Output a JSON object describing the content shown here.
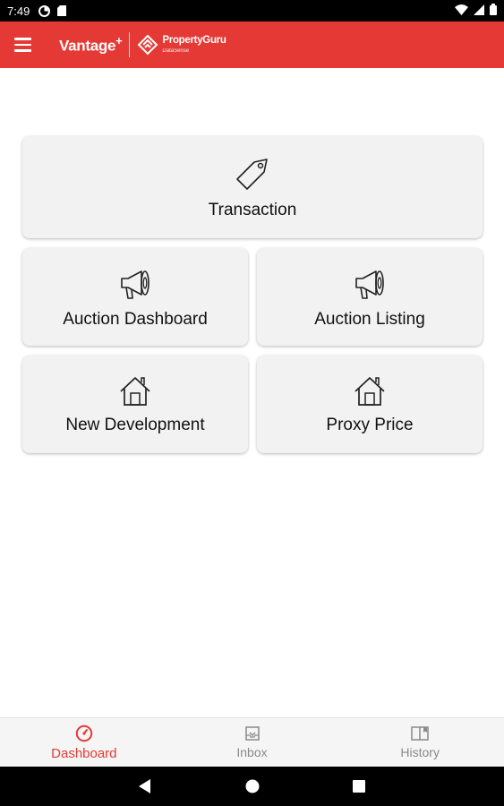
{
  "status_bar": {
    "time": "7:49",
    "icons": [
      "data-saver-icon",
      "sd-card-icon",
      "wifi-icon",
      "signal-icon",
      "battery-icon"
    ]
  },
  "app_bar": {
    "brand_main": "Vantage",
    "brand_plus": "+",
    "brand_partner": "PropertyGuru",
    "brand_partner_sub": "DataSense",
    "color": "#e53935"
  },
  "tiles": [
    {
      "label": "Transaction",
      "icon": "price-tag-icon"
    },
    {
      "label": "Auction Dashboard",
      "icon": "megaphone-icon"
    },
    {
      "label": "Auction Listing",
      "icon": "megaphone-icon"
    },
    {
      "label": "New Development",
      "icon": "house-icon"
    },
    {
      "label": "Proxy Price",
      "icon": "house-icon"
    }
  ],
  "bottom_nav": {
    "items": [
      {
        "label": "Dashboard",
        "icon": "dashboard-gauge-icon",
        "active": true
      },
      {
        "label": "Inbox",
        "icon": "inbox-icon",
        "active": false
      },
      {
        "label": "History",
        "icon": "history-book-icon",
        "active": false
      }
    ],
    "active_color": "#e53935",
    "inactive_color": "#8a8a8a"
  },
  "system_nav": {
    "buttons": [
      "back-button",
      "home-button",
      "recents-button"
    ]
  }
}
